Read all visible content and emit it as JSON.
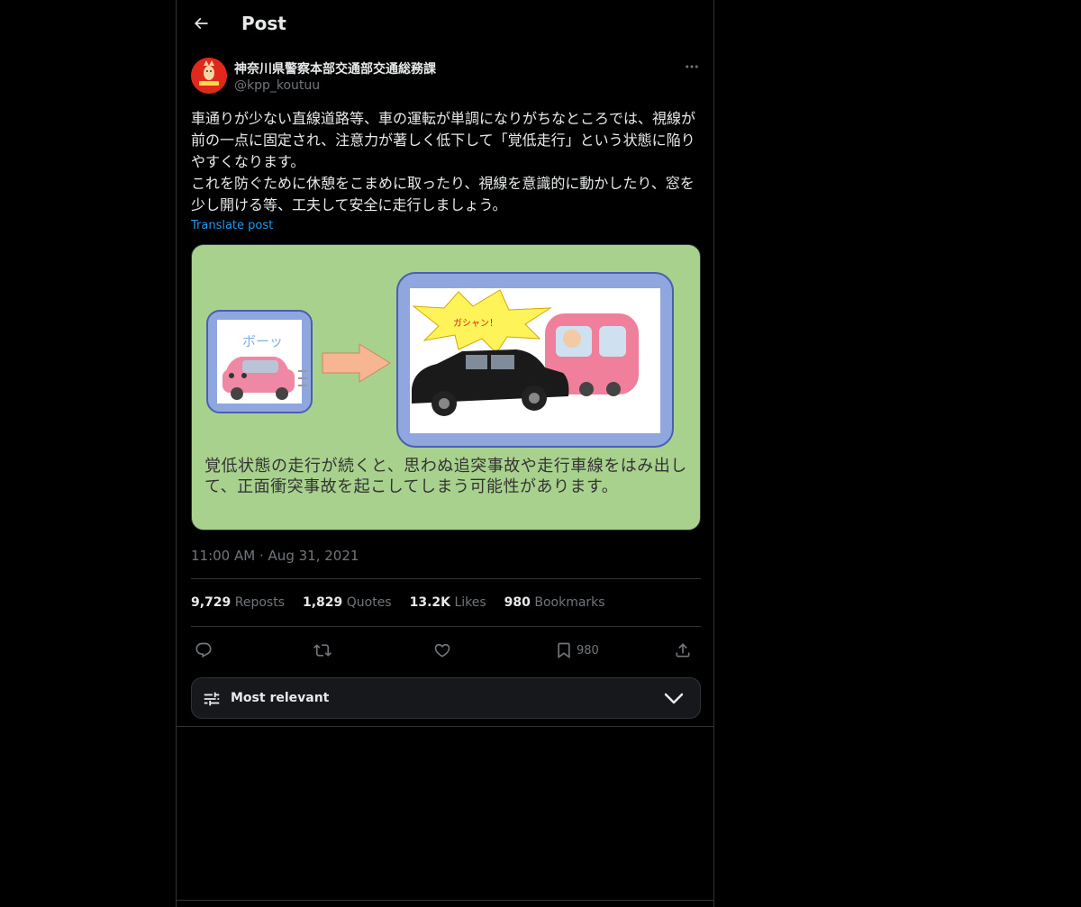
{
  "header": {
    "title": "Post",
    "back_icon": "arrow-left-icon"
  },
  "author": {
    "display_name": "神奈川県警察本部交通部交通総務課",
    "handle": "@kpp_koutuu",
    "avatar_color": "#e0281c"
  },
  "post": {
    "paragraph1": "車通りが少ない直線道路等、車の運転が単調になりがちなところでは、視線が前の一点に固定され、注意力が著しく低下して「覚低走行」という状態に陥りやすくなります。",
    "paragraph2": "これを防ぐために休憩をこまめに取ったり、視線を意識的に動かしたり、窓を少し開ける等、工夫して安全に走行しましょう。",
    "translate_label": "Translate post"
  },
  "media": {
    "caption": "覚低状態の走行が続くと、思わぬ追突事故や走行車線をはみ出して、正面衝突事故を起こしてしまう可能性があります。",
    "left_panel_text": "ボーッ",
    "crash_text": "ガシャン！",
    "background_color": "#a9d18e"
  },
  "meta": {
    "time": "11:00 AM",
    "separator": "·",
    "date": "Aug 31, 2021"
  },
  "stats": {
    "reposts_count": "9,729",
    "reposts_label": "Reposts",
    "quotes_count": "1,829",
    "quotes_label": "Quotes",
    "likes_count": "13.2K",
    "likes_label": "Likes",
    "bookmarks_count": "980",
    "bookmarks_label": "Bookmarks"
  },
  "actions": {
    "reply_icon": "reply-icon",
    "repost_icon": "repost-icon",
    "like_icon": "heart-icon",
    "bookmark_icon": "bookmark-icon",
    "bookmark_count": "980",
    "share_icon": "share-icon"
  },
  "sort": {
    "label": "Most relevant",
    "icon": "sliders-icon",
    "chevron": "chevron-down-icon"
  },
  "colors": {
    "accent": "#1d9bf0",
    "text": "#e7e9ea",
    "muted": "#71767b",
    "border": "#2f3336"
  }
}
